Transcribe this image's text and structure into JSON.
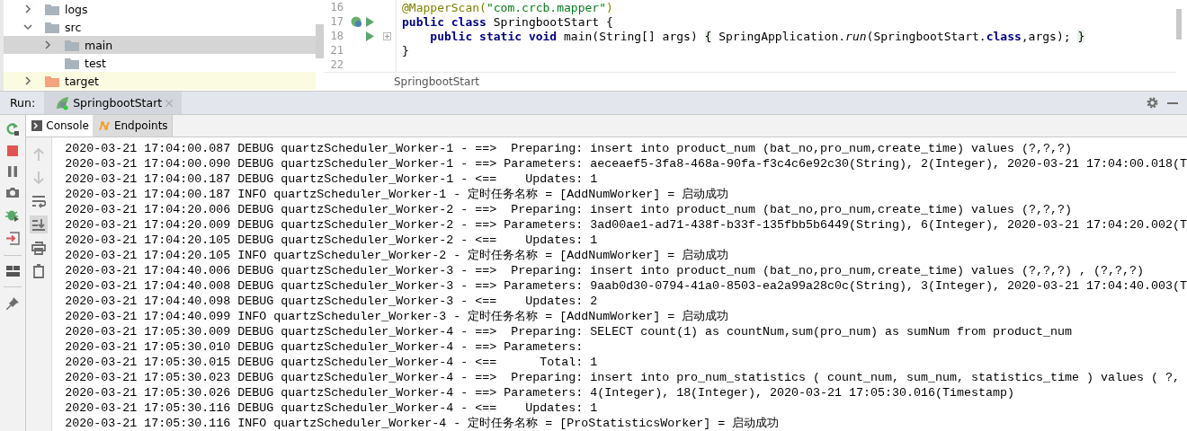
{
  "project_tree": [
    {
      "name": "logs",
      "kind": "folder",
      "expanded": false
    },
    {
      "name": "src",
      "kind": "folder",
      "expanded": true,
      "children": [
        {
          "name": "main",
          "kind": "folder",
          "expanded": false,
          "selected": true
        },
        {
          "name": "test",
          "kind": "folder",
          "selected": false
        }
      ]
    },
    {
      "name": "target",
      "kind": "excluded-folder",
      "expanded": false
    }
  ],
  "editor": {
    "lines": [
      {
        "number": "16",
        "tokens": [
          {
            "kind": "annotation",
            "text": "@MapperScan("
          },
          {
            "kind": "string",
            "text": "\"com.crcb.mapper\""
          },
          {
            "kind": "annotation",
            "text": ")"
          }
        ]
      },
      {
        "number": "17",
        "bean_marker": true,
        "run_marker": true,
        "tokens": [
          {
            "kind": "keyword",
            "text": "public class "
          },
          {
            "kind": "plain",
            "text": "SpringbootStart {"
          }
        ]
      },
      {
        "number": "18",
        "run_marker": true,
        "fold": true,
        "tokens": [
          {
            "kind": "keyword",
            "text": "    public static void "
          },
          {
            "kind": "plain",
            "text": "main(String[] args) "
          },
          {
            "kind": "brace",
            "text": "{"
          },
          {
            "kind": "plain",
            "text": " SpringApplication."
          },
          {
            "kind": "italic",
            "text": "run"
          },
          {
            "kind": "plain",
            "text": "(SpringbootStart."
          },
          {
            "kind": "keyword",
            "text": "class"
          },
          {
            "kind": "plain",
            "text": ",args); "
          },
          {
            "kind": "brace",
            "text": "}"
          }
        ]
      },
      {
        "number": "21",
        "tokens": [
          {
            "kind": "plain",
            "text": "}"
          }
        ]
      },
      {
        "number": "22"
      }
    ],
    "breadcrumb": "SpringbootStart"
  },
  "run_panel": {
    "label": "Run:",
    "tab": {
      "title": "SpringbootStart",
      "selected": true
    },
    "console_tabs": [
      {
        "label": "Console",
        "selected": true
      },
      {
        "label": "Endpoints",
        "selected": false
      }
    ],
    "console_actions": [
      {
        "kind": "up",
        "disabled": true,
        "selected": false
      },
      {
        "kind": "down",
        "disabled": true,
        "selected": false
      },
      {
        "kind": "wrap",
        "disabled": false,
        "selected": false
      },
      {
        "kind": "scroll-end",
        "disabled": false,
        "selected": true
      },
      {
        "kind": "print",
        "disabled": false,
        "selected": false
      },
      {
        "kind": "clear",
        "disabled": false,
        "selected": false
      }
    ],
    "log_lines": [
      "2020-03-21 17:04:00.087 DEBUG quartzScheduler_Worker-1 - ==>  Preparing: insert into product_num (bat_no,pro_num,create_time) values (?,?,?)",
      "2020-03-21 17:04:00.090 DEBUG quartzScheduler_Worker-1 - ==> Parameters: aeceaef5-3fa8-468a-90fa-f3c4c6e92c30(String), 2(Integer), 2020-03-21 17:04:00.018(T",
      "2020-03-21 17:04:00.187 DEBUG quartzScheduler_Worker-1 - <==    Updates: 1",
      "2020-03-21 17:04:00.187 INFO quartzScheduler_Worker-1 - 定时任务名称 = [AddNumWorker] = 启动成功",
      "2020-03-21 17:04:20.006 DEBUG quartzScheduler_Worker-2 - ==>  Preparing: insert into product_num (bat_no,pro_num,create_time) values (?,?,?)",
      "2020-03-21 17:04:20.009 DEBUG quartzScheduler_Worker-2 - ==> Parameters: 3ad00ae1-ad71-438f-b33f-135fbb5b6449(String), 6(Integer), 2020-03-21 17:04:20.002(T",
      "2020-03-21 17:04:20.105 DEBUG quartzScheduler_Worker-2 - <==    Updates: 1",
      "2020-03-21 17:04:20.105 INFO quartzScheduler_Worker-2 - 定时任务名称 = [AddNumWorker] = 启动成功",
      "2020-03-21 17:04:40.006 DEBUG quartzScheduler_Worker-3 - ==>  Preparing: insert into product_num (bat_no,pro_num,create_time) values (?,?,?) , (?,?,?)",
      "2020-03-21 17:04:40.008 DEBUG quartzScheduler_Worker-3 - ==> Parameters: 9aab0d30-0794-41a0-8503-ea2a99a28c0c(String), 3(Integer), 2020-03-21 17:04:40.003(T",
      "2020-03-21 17:04:40.098 DEBUG quartzScheduler_Worker-3 - <==    Updates: 2",
      "2020-03-21 17:04:40.099 INFO quartzScheduler_Worker-3 - 定时任务名称 = [AddNumWorker] = 启动成功",
      "2020-03-21 17:05:30.009 DEBUG quartzScheduler_Worker-4 - ==>  Preparing: SELECT count(1) as countNum,sum(pro_num) as sumNum from product_num",
      "2020-03-21 17:05:30.010 DEBUG quartzScheduler_Worker-4 - ==> Parameters: ",
      "2020-03-21 17:05:30.015 DEBUG quartzScheduler_Worker-4 - <==      Total: 1",
      "2020-03-21 17:05:30.023 DEBUG quartzScheduler_Worker-4 - ==>  Preparing: insert into pro_num_statistics ( count_num, sum_num, statistics_time ) values ( ?,",
      "2020-03-21 17:05:30.026 DEBUG quartzScheduler_Worker-4 - ==> Parameters: 4(Integer), 18(Integer), 2020-03-21 17:05:30.016(Timestamp)",
      "2020-03-21 17:05:30.116 DEBUG quartzScheduler_Worker-4 - <==    Updates: 1",
      "2020-03-21 17:05:30.116 INFO quartzScheduler_Worker-4 - 定时任务名称 = [ProStatisticsWorker] = 启动成功"
    ]
  }
}
